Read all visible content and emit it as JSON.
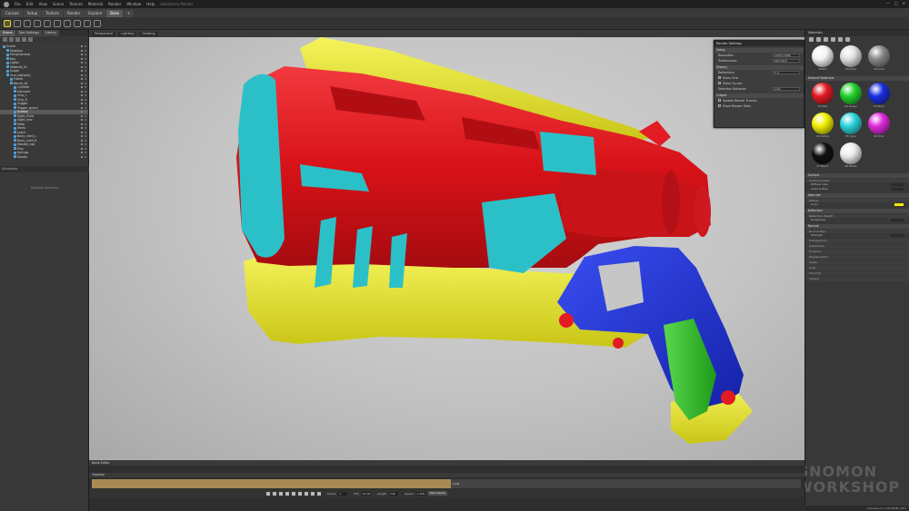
{
  "titlebar": {
    "menus": [
      "File",
      "Edit",
      "View",
      "Scene",
      "Texture",
      "Material",
      "Render",
      "Window",
      "Help"
    ],
    "title": "Substance Painter",
    "controls": [
      "—",
      "□",
      "✕"
    ]
  },
  "tabs": [
    "Canvas",
    "Setup",
    "Texture",
    "Render",
    "Explore",
    "Bake",
    "+"
  ],
  "tools": [
    "select-tool",
    "move-tool",
    "rotate-tool",
    "scale-tool",
    "brush-tool",
    "eraser-tool",
    "sphere-tool",
    "box-tool",
    "lasso-tool",
    "grid-tool"
  ],
  "left_panel": {
    "tabs": [
      "Scene",
      "Tool Settings",
      "Library"
    ],
    "tree": [
      "Scene",
      "Displays",
      "PerspCamera",
      "Ray",
      "Lights",
      "Material_01",
      "Scope",
      "Gun_highpoly",
      "Frame",
      "Barrel_01",
      "Cylinder",
      "Hammer",
      "Grip_L",
      "Grip_R",
      "Trigger",
      "Trigger_guard",
      "Screws",
      "Sight_front",
      "Sight_rear",
      "Slide",
      "Vents",
      "Latch",
      "Body_shell_L",
      "Body_shell_R",
      "Handle_cap",
      "Pins",
      "Springs",
      "Decals"
    ],
    "selected_index": 16,
    "attributes_label": "Attributes",
    "empty_text": "Multiple Selected"
  },
  "viewport": {
    "header": [
      "Perspective",
      "Lighting",
      "Shading"
    ],
    "colors": {
      "red": "#e31b23",
      "yellow": "#e6e41d",
      "cyan": "#2bc0c8",
      "blue": "#2434d8",
      "green": "#2fbf2a"
    }
  },
  "float_panel": {
    "title": "Render Settings",
    "sections": [
      {
        "label": "Setup",
        "rows": [
          {
            "label": "Resolution",
            "value": "1920×1080"
          },
          {
            "label": "Subdivisions",
            "value": "Standard"
          }
        ]
      },
      {
        "label": "Display",
        "rows": [
          {
            "label": "Reflections",
            "value": "0.4"
          },
          {
            "label": "Show Grid",
            "value": ""
          },
          {
            "label": "Show Curves",
            "value": ""
          },
          {
            "label": "Selection Behavior",
            "value": "Auto"
          }
        ]
      },
      {
        "label": "Output",
        "rows": [
          {
            "label": "Update Render Frames",
            "value": ""
          },
          {
            "label": "Show Render Stats",
            "value": ""
          }
        ]
      }
    ]
  },
  "right_panel": {
    "header": "Materials",
    "section_basic": "Default Materials",
    "materials_top": [
      {
        "name": "White",
        "color": "#f2f2f2"
      },
      {
        "name": "Ceramic",
        "color": "#e0e0e0"
      },
      {
        "name": "Chrome",
        "color": "#8a8a8a"
      }
    ],
    "materials": [
      {
        "name": "01 Red",
        "color": "#e31b23"
      },
      {
        "name": "02 Green",
        "color": "#22d12b"
      },
      {
        "name": "03 Blue",
        "color": "#1b2fe0"
      },
      {
        "name": "04 Yellow",
        "color": "#f0f000"
      },
      {
        "name": "05 Cyan",
        "color": "#2bd4dc"
      },
      {
        "name": "06 Pink",
        "color": "#e02bdc"
      },
      {
        "name": "07 Black",
        "color": "#111111"
      },
      {
        "name": "08 White",
        "color": "#ececec"
      }
    ],
    "attr_sections": [
      {
        "label": "Surface",
        "sub": "Surface Shader",
        "rows": [
          {
            "label": "Diffuse Color",
            "value": ""
          },
          {
            "label": "Scale & Bias",
            "value": "0"
          }
        ]
      },
      {
        "label": "Specular",
        "sub": "Diffuse",
        "rows": [
          {
            "label": "Color",
            "value": "yellow"
          }
        ]
      },
      {
        "label": "Reflection",
        "sub": "Reflection Weight",
        "rows": [
          {
            "label": "Roughness",
            "value": ""
          }
        ]
      },
      {
        "label": "Normal",
        "sub": "Normal Map",
        "rows": [
          {
            "label": "Strength",
            "value": ""
          }
        ]
      }
    ],
    "collapsed_items": [
      "Transparency",
      "Subsurface",
      "Emission",
      "Displacement",
      "Sheen",
      "Coat",
      "Thin Film",
      "Volume"
    ]
  },
  "watermark": {
    "line1": "GNOMON",
    "line2": "WORKSHOP"
  },
  "bottom": {
    "tab1": "Node Editor",
    "tab2": "Timeline",
    "timeline_progress": 0.507,
    "timeline_end_label": "1-241",
    "fields": [
      {
        "label": "Frame",
        "value": "1"
      },
      {
        "label": "FPS",
        "value": "24.00"
      },
      {
        "label": "Length",
        "value": "240"
      },
      {
        "label": "Speed",
        "value": "1.000"
      }
    ],
    "rate_button": "Rate Speed"
  },
  "status": "Autosave in 1:56  VRAM: 58%"
}
